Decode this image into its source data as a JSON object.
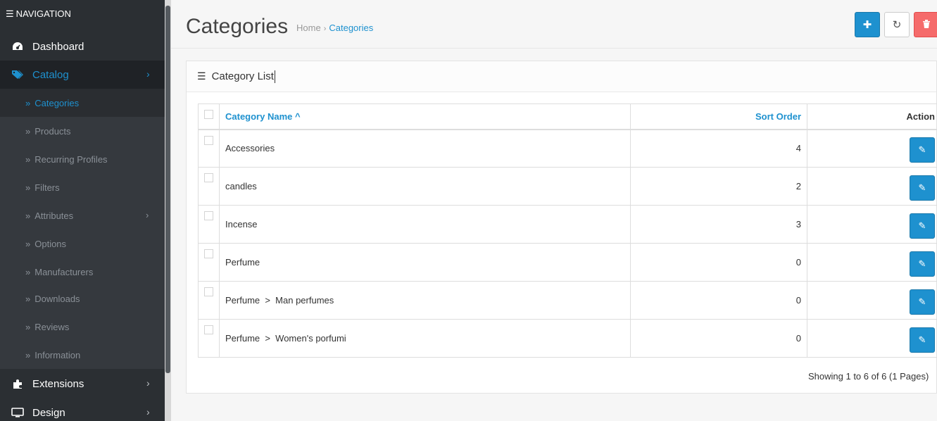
{
  "navigation": {
    "heading": "NAVIGATION",
    "items": [
      {
        "label": "Dashboard",
        "icon": "dashboard-icon"
      },
      {
        "label": "Catalog",
        "icon": "tags-icon",
        "chevron": "›"
      },
      {
        "label": "Extensions",
        "icon": "puzzle-icon",
        "chevron": "›"
      },
      {
        "label": "Design",
        "icon": "monitor-icon",
        "chevron": "›"
      }
    ],
    "submenu": [
      {
        "label": "Categories"
      },
      {
        "label": "Products"
      },
      {
        "label": "Recurring Profiles"
      },
      {
        "label": "Filters"
      },
      {
        "label": "Attributes",
        "chevron": "›"
      },
      {
        "label": "Options"
      },
      {
        "label": "Manufacturers"
      },
      {
        "label": "Downloads"
      },
      {
        "label": "Reviews"
      },
      {
        "label": "Information"
      }
    ],
    "submenu_mark": "»"
  },
  "header": {
    "title": "Categories",
    "breadcrumb": {
      "home": "Home",
      "separator": "›",
      "current": "Categories"
    }
  },
  "panel": {
    "title": "Category List"
  },
  "table": {
    "columns": {
      "name": "Category Name ^",
      "sort": "Sort Order",
      "action": "Action"
    },
    "rows": [
      {
        "name": "Accessories",
        "sort": "4"
      },
      {
        "name": "candles",
        "sort": "2"
      },
      {
        "name": "Incense",
        "sort": "3"
      },
      {
        "name": "Perfume",
        "sort": "0"
      },
      {
        "name": "Perfume  >  Man perfumes",
        "sort": "0"
      },
      {
        "name": "Perfume  >  Women's porfumi",
        "sort": "0"
      }
    ]
  },
  "pagination": {
    "summary": "Showing 1 to 6 of 6 (1 Pages)"
  },
  "colors": {
    "sidebar_bg": "#2b2f33",
    "accent": "#1e91cf",
    "danger": "#f56b6b"
  }
}
